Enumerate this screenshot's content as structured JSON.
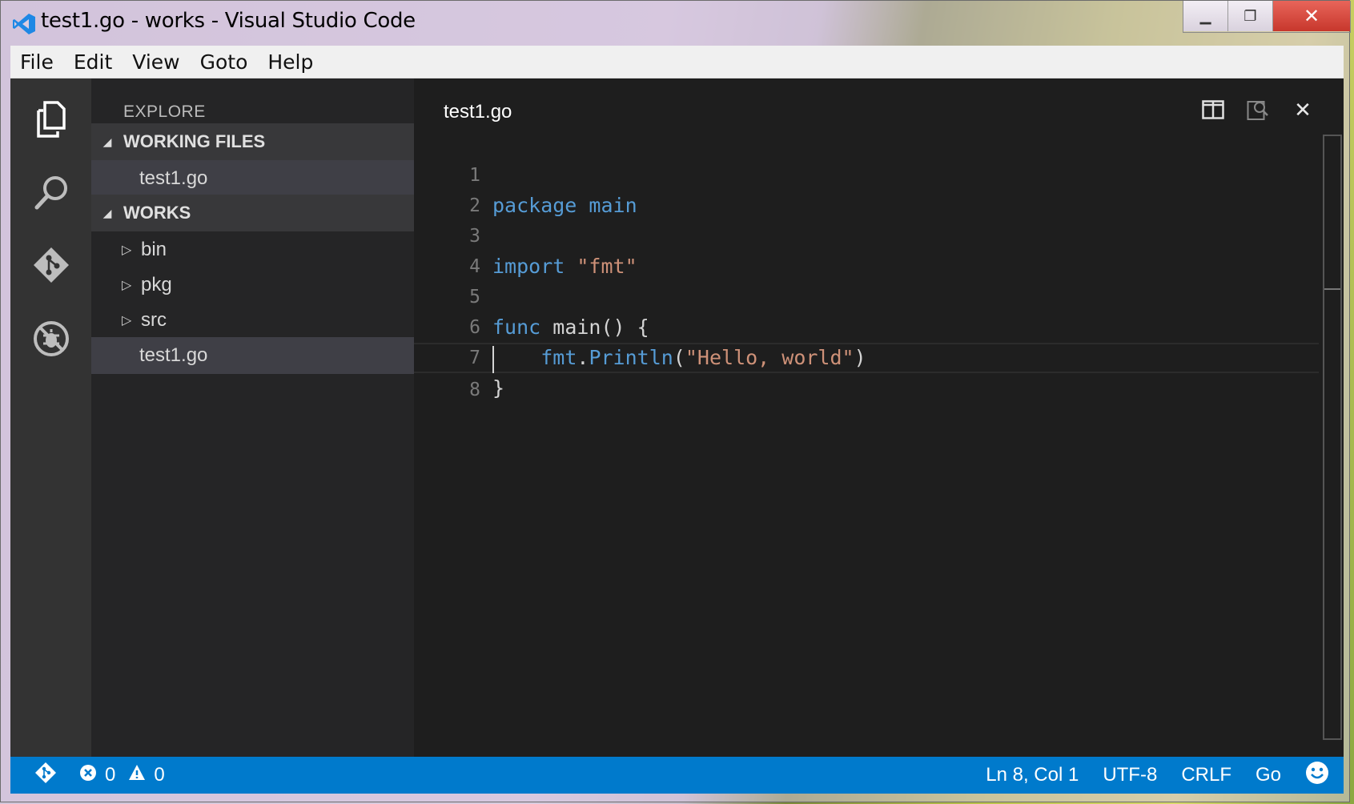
{
  "window": {
    "title": "test1.go - works - Visual Studio Code",
    "logo_icon": "vscode-logo-icon",
    "buttons": {
      "minimize": "minimize-icon",
      "maximize": "maximize-icon",
      "close": "close-icon"
    }
  },
  "menubar": {
    "items": [
      "File",
      "Edit",
      "View",
      "Goto",
      "Help"
    ]
  },
  "activitybar": {
    "icons": [
      "explorer-icon",
      "search-icon",
      "git-icon",
      "debug-icon"
    ]
  },
  "sidebar": {
    "title": "EXPLORE",
    "working_files": {
      "header": "WORKING FILES",
      "items": [
        "test1.go"
      ]
    },
    "works": {
      "header": "WORKS",
      "folders": [
        "bin",
        "pkg",
        "src"
      ],
      "files": [
        "test1.go"
      ]
    }
  },
  "editor": {
    "tab_title": "test1.go",
    "actions": [
      "split-editor-icon",
      "open-preview-icon",
      "close-editor-icon"
    ],
    "line_numbers": [
      "1",
      "2",
      "3",
      "4",
      "5",
      "6",
      "7",
      "8"
    ],
    "code": {
      "l1_kw": "package",
      "l1_id": "main",
      "l3_kw": "import",
      "l3_str": "\"fmt\"",
      "l5_kw": "func",
      "l5_rest": "main() {",
      "l6_obj": "fmt",
      "l6_dot": ".",
      "l6_fn": "Println",
      "l6_open": "(",
      "l6_str": "\"Hello, world\"",
      "l6_close": ")",
      "l7": "}"
    }
  },
  "statusbar": {
    "git_icon": "git-branch-icon",
    "errors": "0",
    "warnings": "0",
    "position": "Ln 8, Col 1",
    "encoding": "UTF-8",
    "eol": "CRLF",
    "language": "Go",
    "feedback_icon": "smiley-icon"
  },
  "colors": {
    "accent": "#007acc",
    "keyword": "#569cd6",
    "string": "#ce9178",
    "editor_bg": "#1e1e1e"
  }
}
